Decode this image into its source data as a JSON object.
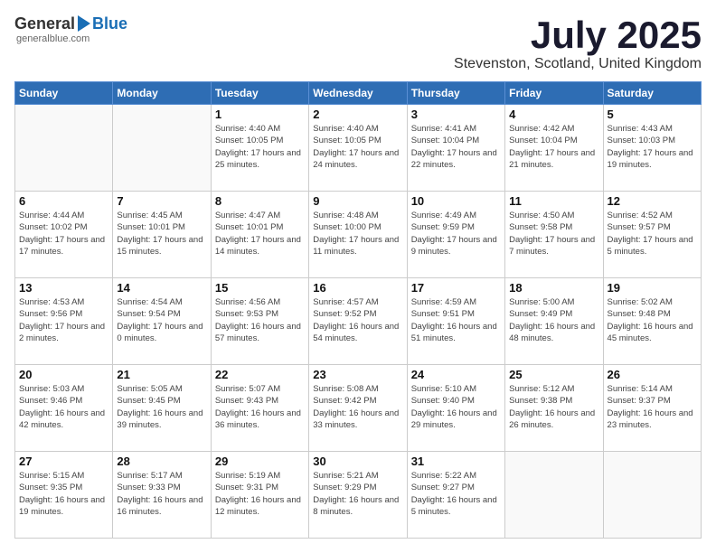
{
  "logo": {
    "general": "General",
    "blue": "Blue",
    "subtitle": "generalblue.com"
  },
  "header": {
    "month": "July 2025",
    "location": "Stevenston, Scotland, United Kingdom"
  },
  "days_of_week": [
    "Sunday",
    "Monday",
    "Tuesday",
    "Wednesday",
    "Thursday",
    "Friday",
    "Saturday"
  ],
  "weeks": [
    [
      {
        "day": "",
        "sunrise": "",
        "sunset": "",
        "daylight": "",
        "empty": true
      },
      {
        "day": "",
        "sunrise": "",
        "sunset": "",
        "daylight": "",
        "empty": true
      },
      {
        "day": "1",
        "sunrise": "Sunrise: 4:40 AM",
        "sunset": "Sunset: 10:05 PM",
        "daylight": "Daylight: 17 hours and 25 minutes.",
        "empty": false
      },
      {
        "day": "2",
        "sunrise": "Sunrise: 4:40 AM",
        "sunset": "Sunset: 10:05 PM",
        "daylight": "Daylight: 17 hours and 24 minutes.",
        "empty": false
      },
      {
        "day": "3",
        "sunrise": "Sunrise: 4:41 AM",
        "sunset": "Sunset: 10:04 PM",
        "daylight": "Daylight: 17 hours and 22 minutes.",
        "empty": false
      },
      {
        "day": "4",
        "sunrise": "Sunrise: 4:42 AM",
        "sunset": "Sunset: 10:04 PM",
        "daylight": "Daylight: 17 hours and 21 minutes.",
        "empty": false
      },
      {
        "day": "5",
        "sunrise": "Sunrise: 4:43 AM",
        "sunset": "Sunset: 10:03 PM",
        "daylight": "Daylight: 17 hours and 19 minutes.",
        "empty": false
      }
    ],
    [
      {
        "day": "6",
        "sunrise": "Sunrise: 4:44 AM",
        "sunset": "Sunset: 10:02 PM",
        "daylight": "Daylight: 17 hours and 17 minutes.",
        "empty": false
      },
      {
        "day": "7",
        "sunrise": "Sunrise: 4:45 AM",
        "sunset": "Sunset: 10:01 PM",
        "daylight": "Daylight: 17 hours and 15 minutes.",
        "empty": false
      },
      {
        "day": "8",
        "sunrise": "Sunrise: 4:47 AM",
        "sunset": "Sunset: 10:01 PM",
        "daylight": "Daylight: 17 hours and 14 minutes.",
        "empty": false
      },
      {
        "day": "9",
        "sunrise": "Sunrise: 4:48 AM",
        "sunset": "Sunset: 10:00 PM",
        "daylight": "Daylight: 17 hours and 11 minutes.",
        "empty": false
      },
      {
        "day": "10",
        "sunrise": "Sunrise: 4:49 AM",
        "sunset": "Sunset: 9:59 PM",
        "daylight": "Daylight: 17 hours and 9 minutes.",
        "empty": false
      },
      {
        "day": "11",
        "sunrise": "Sunrise: 4:50 AM",
        "sunset": "Sunset: 9:58 PM",
        "daylight": "Daylight: 17 hours and 7 minutes.",
        "empty": false
      },
      {
        "day": "12",
        "sunrise": "Sunrise: 4:52 AM",
        "sunset": "Sunset: 9:57 PM",
        "daylight": "Daylight: 17 hours and 5 minutes.",
        "empty": false
      }
    ],
    [
      {
        "day": "13",
        "sunrise": "Sunrise: 4:53 AM",
        "sunset": "Sunset: 9:56 PM",
        "daylight": "Daylight: 17 hours and 2 minutes.",
        "empty": false
      },
      {
        "day": "14",
        "sunrise": "Sunrise: 4:54 AM",
        "sunset": "Sunset: 9:54 PM",
        "daylight": "Daylight: 17 hours and 0 minutes.",
        "empty": false
      },
      {
        "day": "15",
        "sunrise": "Sunrise: 4:56 AM",
        "sunset": "Sunset: 9:53 PM",
        "daylight": "Daylight: 16 hours and 57 minutes.",
        "empty": false
      },
      {
        "day": "16",
        "sunrise": "Sunrise: 4:57 AM",
        "sunset": "Sunset: 9:52 PM",
        "daylight": "Daylight: 16 hours and 54 minutes.",
        "empty": false
      },
      {
        "day": "17",
        "sunrise": "Sunrise: 4:59 AM",
        "sunset": "Sunset: 9:51 PM",
        "daylight": "Daylight: 16 hours and 51 minutes.",
        "empty": false
      },
      {
        "day": "18",
        "sunrise": "Sunrise: 5:00 AM",
        "sunset": "Sunset: 9:49 PM",
        "daylight": "Daylight: 16 hours and 48 minutes.",
        "empty": false
      },
      {
        "day": "19",
        "sunrise": "Sunrise: 5:02 AM",
        "sunset": "Sunset: 9:48 PM",
        "daylight": "Daylight: 16 hours and 45 minutes.",
        "empty": false
      }
    ],
    [
      {
        "day": "20",
        "sunrise": "Sunrise: 5:03 AM",
        "sunset": "Sunset: 9:46 PM",
        "daylight": "Daylight: 16 hours and 42 minutes.",
        "empty": false
      },
      {
        "day": "21",
        "sunrise": "Sunrise: 5:05 AM",
        "sunset": "Sunset: 9:45 PM",
        "daylight": "Daylight: 16 hours and 39 minutes.",
        "empty": false
      },
      {
        "day": "22",
        "sunrise": "Sunrise: 5:07 AM",
        "sunset": "Sunset: 9:43 PM",
        "daylight": "Daylight: 16 hours and 36 minutes.",
        "empty": false
      },
      {
        "day": "23",
        "sunrise": "Sunrise: 5:08 AM",
        "sunset": "Sunset: 9:42 PM",
        "daylight": "Daylight: 16 hours and 33 minutes.",
        "empty": false
      },
      {
        "day": "24",
        "sunrise": "Sunrise: 5:10 AM",
        "sunset": "Sunset: 9:40 PM",
        "daylight": "Daylight: 16 hours and 29 minutes.",
        "empty": false
      },
      {
        "day": "25",
        "sunrise": "Sunrise: 5:12 AM",
        "sunset": "Sunset: 9:38 PM",
        "daylight": "Daylight: 16 hours and 26 minutes.",
        "empty": false
      },
      {
        "day": "26",
        "sunrise": "Sunrise: 5:14 AM",
        "sunset": "Sunset: 9:37 PM",
        "daylight": "Daylight: 16 hours and 23 minutes.",
        "empty": false
      }
    ],
    [
      {
        "day": "27",
        "sunrise": "Sunrise: 5:15 AM",
        "sunset": "Sunset: 9:35 PM",
        "daylight": "Daylight: 16 hours and 19 minutes.",
        "empty": false
      },
      {
        "day": "28",
        "sunrise": "Sunrise: 5:17 AM",
        "sunset": "Sunset: 9:33 PM",
        "daylight": "Daylight: 16 hours and 16 minutes.",
        "empty": false
      },
      {
        "day": "29",
        "sunrise": "Sunrise: 5:19 AM",
        "sunset": "Sunset: 9:31 PM",
        "daylight": "Daylight: 16 hours and 12 minutes.",
        "empty": false
      },
      {
        "day": "30",
        "sunrise": "Sunrise: 5:21 AM",
        "sunset": "Sunset: 9:29 PM",
        "daylight": "Daylight: 16 hours and 8 minutes.",
        "empty": false
      },
      {
        "day": "31",
        "sunrise": "Sunrise: 5:22 AM",
        "sunset": "Sunset: 9:27 PM",
        "daylight": "Daylight: 16 hours and 5 minutes.",
        "empty": false
      },
      {
        "day": "",
        "sunrise": "",
        "sunset": "",
        "daylight": "",
        "empty": true
      },
      {
        "day": "",
        "sunrise": "",
        "sunset": "",
        "daylight": "",
        "empty": true
      }
    ]
  ]
}
